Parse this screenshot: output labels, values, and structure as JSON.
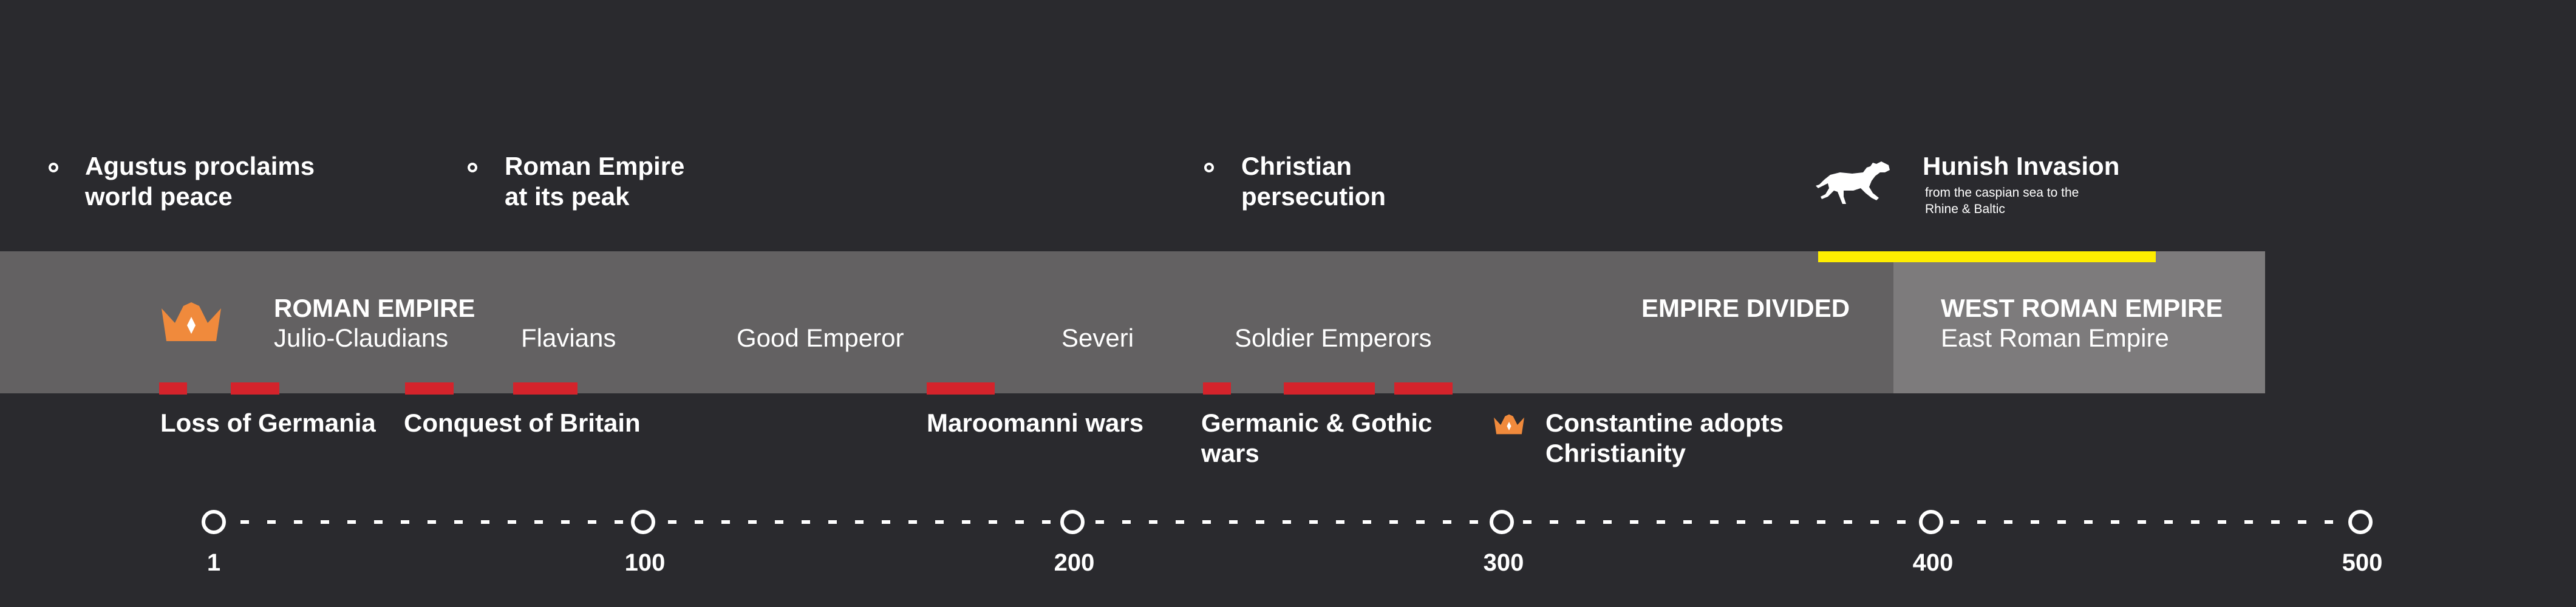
{
  "top_events": [
    {
      "lines": [
        "Agustus proclaims",
        "world peace"
      ]
    },
    {
      "lines": [
        "Roman Empire",
        "at its peak"
      ]
    },
    {
      "lines": [
        "Christian",
        "persecution"
      ]
    }
  ],
  "hunish": {
    "title": "Hunish Invasion",
    "subtitle_lines": [
      "from the caspian sea to the",
      "Rhine & Baltic"
    ],
    "icon": "horse-icon"
  },
  "band": {
    "roman_empire_title": "ROMAN EMPIRE",
    "eras": [
      "Julio-Claudians",
      "Flavians",
      "Good Emperor",
      "Severi",
      "Soldier Emperors"
    ],
    "empire_divided": "EMPIRE DIVIDED",
    "west_title": "WEST ROMAN EMPIRE",
    "east_label": "East Roman Empire",
    "crown_icon": "crown-icon"
  },
  "bottom_events": [
    {
      "lines": [
        "Loss of Germania"
      ]
    },
    {
      "lines": [
        "Conquest of Britain"
      ]
    },
    {
      "lines": [
        "Maroomanni wars"
      ]
    },
    {
      "lines": [
        "Germanic & Gothic",
        "wars"
      ]
    },
    {
      "lines": [
        "Constantine adopts",
        "Christianity"
      ]
    }
  ],
  "axis": {
    "ticks": [
      "1",
      "100",
      "200",
      "300",
      "400",
      "500"
    ]
  },
  "colors": {
    "background": "#2a2a2e",
    "band": "#636162",
    "band_west": "#7d7b7c",
    "accent_red": "#d4232b",
    "accent_orange": "#f08a3c",
    "accent_yellow": "#ffee00"
  }
}
